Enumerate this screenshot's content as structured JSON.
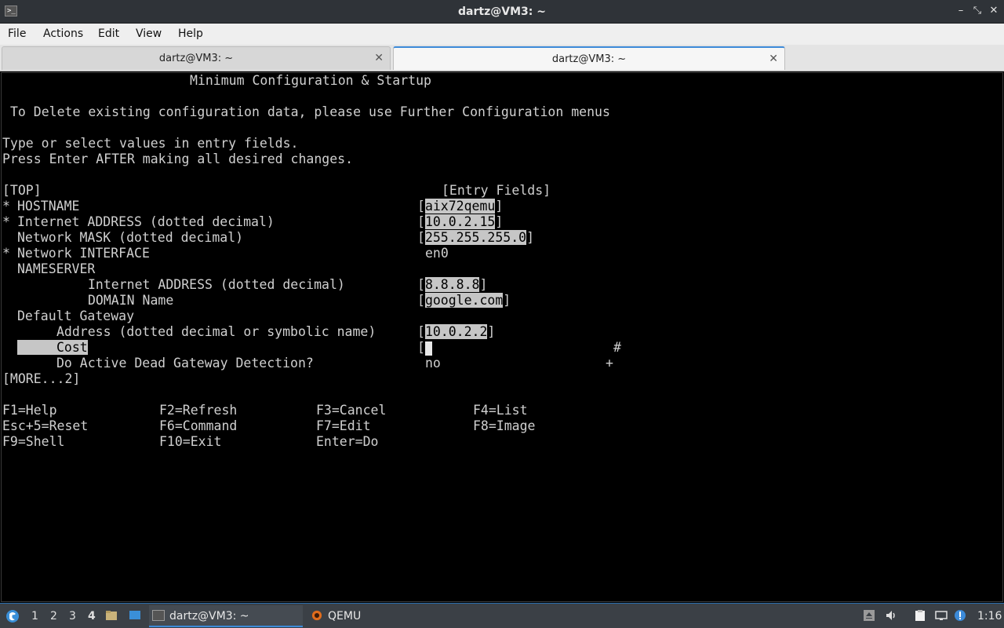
{
  "window": {
    "title": "dartz@VM3: ~",
    "app_icon_glyph": ">_",
    "minimize_glyph": "–",
    "maximize_glyph": "⤡",
    "close_glyph": "✕"
  },
  "menu": [
    "File",
    "Actions",
    "Edit",
    "View",
    "Help"
  ],
  "tabs": [
    {
      "label": "dartz@VM3: ~",
      "close": "✕",
      "active": false
    },
    {
      "label": "dartz@VM3: ~",
      "close": "✕",
      "active": true
    }
  ],
  "terminal": {
    "heading": "Minimum Configuration & Startup",
    "note": "To Delete existing configuration data, please use Further Configuration menus",
    "instruction1": "Type or select values in entry fields.",
    "instruction2": "Press Enter AFTER making all desired changes.",
    "top_marker": "[TOP]",
    "entry_header": "[Entry Fields]",
    "fields": [
      {
        "marker": "*",
        "label": "HOSTNAME",
        "value": "aix72qemu",
        "boxed": true,
        "suffix": ""
      },
      {
        "marker": "*",
        "label": "Internet ADDRESS (dotted decimal)",
        "value": "10.0.2.15",
        "boxed": true,
        "suffix": ""
      },
      {
        "marker": "",
        "label": "Network MASK (dotted decimal)",
        "value": "255.255.255.0",
        "boxed": true,
        "suffix": ""
      },
      {
        "marker": "*",
        "label": "Network INTERFACE",
        "value": "en0",
        "boxed": false,
        "suffix": ""
      },
      {
        "marker": "",
        "label": "NAMESERVER",
        "value": "",
        "boxed": false,
        "suffix": ""
      },
      {
        "marker": "",
        "label": "Internet ADDRESS (dotted decimal)",
        "value": "8.8.8.8",
        "boxed": true,
        "suffix": ""
      },
      {
        "marker": "",
        "label": "DOMAIN Name",
        "value": "google.com",
        "boxed": true,
        "suffix": ""
      },
      {
        "marker": "",
        "label": "Default Gateway",
        "value": "",
        "boxed": false,
        "suffix": ""
      },
      {
        "marker": "",
        "label": "Address (dotted decimal or symbolic name)",
        "value": "10.0.2.2",
        "boxed": true,
        "suffix": ""
      },
      {
        "marker": "",
        "label": "Cost",
        "value": "",
        "boxed": true,
        "suffix": "#"
      },
      {
        "marker": "",
        "label": "Do Active Dead Gateway Detection?",
        "value": "no",
        "boxed": false,
        "suffix": "+"
      }
    ],
    "more_marker": "[MORE...2]",
    "fkeys": [
      [
        "F1=Help",
        "F2=Refresh",
        "F3=Cancel",
        "F4=List"
      ],
      [
        "Esc+5=Reset",
        "F6=Command",
        "F7=Edit",
        "F8=Image"
      ],
      [
        "F9=Shell",
        "F10=Exit",
        "Enter=Do",
        ""
      ]
    ]
  },
  "taskbar": {
    "desktops": [
      "1",
      "2",
      "3",
      "4"
    ],
    "active_desktop": "4",
    "tasks": [
      {
        "label": "dartz@VM3: ~",
        "icon": "terminal-icon"
      },
      {
        "label": "QEMU",
        "icon": "qemu-icon"
      }
    ],
    "clock": "1:16"
  },
  "colors": {
    "titlebar": "#2f3338",
    "terminal_bg": "#000000",
    "terminal_fg": "#d0d0d0",
    "field_highlight": "#c6c6c6",
    "taskbar": "#3b4046",
    "accent": "#3c8ad8"
  }
}
